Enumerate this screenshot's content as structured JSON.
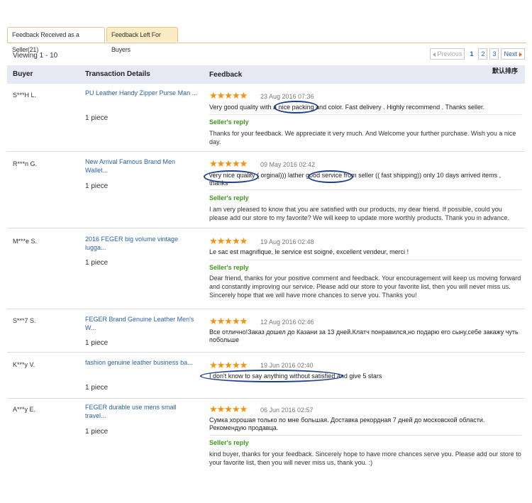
{
  "tabs": [
    {
      "label": "Feedback Received as a Seller(21)",
      "active": true
    },
    {
      "label": "Feedback Left For Buyers",
      "active": false
    }
  ],
  "viewing": "Viewing 1 - 10",
  "pagination": {
    "prev": "Previous",
    "pages": [
      "1",
      "2",
      "3"
    ],
    "current": "1",
    "next": "Next"
  },
  "columns": {
    "buyer": "Buyer",
    "transaction": "Transaction Details",
    "feedback": "Feedback"
  },
  "sort_label": "默认排序",
  "reply_heading": "Seller's reply",
  "star_glyphs": "★★★★★",
  "rows": [
    {
      "buyer": "S***H L.",
      "product": "PU Leather Handy Zipper Purse Man ...",
      "qty": "1 piece",
      "rating": 5,
      "date": "23 Aug 2016 07:36",
      "feedback": "Very good quality with a nice packing and color. Fast delivery . Highly recommend . Thanks seller.",
      "reply": "Thanks for your feedback. We appreciate it very much. And Welcome your further purchase. Wish you a nice day."
    },
    {
      "buyer": "R***n G.",
      "product": "New Arrival Famous Brand Men Wallet...",
      "qty": "1 piece",
      "rating": 5,
      "date": "09 May 2016 02:42",
      "feedback": "very nice quality ( orginal))) lather good service from seller (( fast shipping)) only 10 days arrived items , thanks",
      "reply": "I am very pleased to know that you are satisfied with our products, my dear friend. If possible, could you please add our store to my favorite? We will keep to update more worthly products. Thank you in advance."
    },
    {
      "buyer": "M***e S.",
      "product": "2016 FEGER big volume vintage lugga...",
      "qty": "1 piece",
      "rating": 5,
      "date": "19 Aug 2016 02:48",
      "feedback": "Le sac est magnifique, le service est soigné, excellent vendeur, merci !",
      "reply": "Dear friend, thanks for your positive comment and feedback. Your encouragement will keep us moving forward and constantly improving our service. Please add our store to your favorite list, then you will never miss us. Sincerely hope that we will have more chances to serve you. Thanks you!"
    },
    {
      "buyer": "S***7 S.",
      "product": "FEGER Brand Genuine Leather Men's W...",
      "qty": "1 piece",
      "rating": 5,
      "date": "12 Aug 2016 02:46",
      "feedback": "Все отлично!Заказ дошел до Казани за 13 дней.Клатч понравился,но подарю его сыну,себе закажу чуть побольше",
      "reply": ""
    },
    {
      "buyer": "K***y V.",
      "product": "fashion genuine leather business ba...",
      "qty": "1 piece",
      "rating": 5,
      "date": "19 Jun 2016 02:40",
      "feedback": "I don't know to say anything without satisfied and give 5 stars",
      "reply": ""
    },
    {
      "buyer": "A***y E.",
      "product": "FEGER durable use mens small travel...",
      "qty": "1 piece",
      "rating": 5,
      "date": "06 Jun 2016 02:57",
      "feedback": "Сумка хорошая только по мне большая. Доставка рекордная 7 дней до московской области. Рекомендую продавца.",
      "reply": "kind buyer, thanks for your feedback. Sincerely hope to have more chances serve you. Please add our store to your favorite list, then you will never miss us, thank you. :)"
    }
  ],
  "colors": {
    "link": "#2b62a8",
    "star": "#f6920b",
    "reply_heading": "#3a9a17",
    "header_bg": "#e6e9f4",
    "tab_bg": "#fcecc4",
    "annotation": "#1f3f8f"
  }
}
